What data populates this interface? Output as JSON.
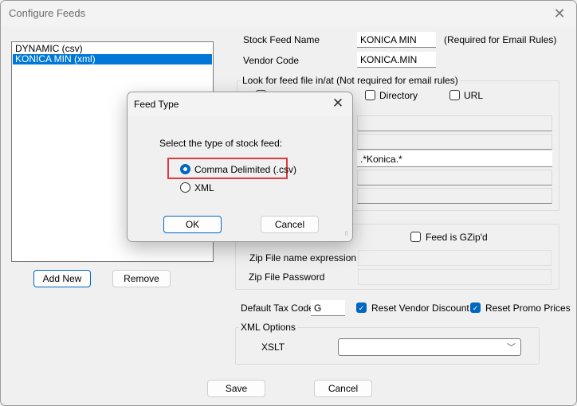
{
  "window": {
    "title": "Configure Feeds",
    "close_icon": "close-icon"
  },
  "feeds_list": {
    "items": [
      {
        "label": "DYNAMIC (csv)",
        "selected": false
      },
      {
        "label": "KONICA MIN (xml)",
        "selected": true
      }
    ]
  },
  "list_buttons": {
    "add_new": "Add New",
    "remove": "Remove"
  },
  "form": {
    "stock_feed_name_label": "Stock Feed Name",
    "stock_feed_name_value": "KONICA MIN",
    "stock_feed_name_hint": "(Required for Email Rules)",
    "vendor_code_label": "Vendor Code",
    "vendor_code_value": "KONICA.MIN",
    "look_for_group_label": "Look for feed file in/at (Not required for email rules)",
    "directory_label": "Directory",
    "directory_checked": false,
    "url_label": "URL",
    "url_checked": false,
    "field_values": [
      "",
      "",
      ".*Konica.*",
      "",
      ""
    ],
    "feed_gzip_label": "Feed is GZip'd",
    "feed_gzip_checked": false,
    "zip_name_label": "Zip File name expression",
    "zip_name_value": "",
    "zip_password_label": "Zip File Password",
    "zip_password_value": "",
    "default_tax_code_label": "Default Tax Code",
    "default_tax_code_value": "G",
    "reset_vendor_discount_label": "Reset Vendor Discount",
    "reset_vendor_discount_checked": true,
    "reset_promo_prices_label": "Reset Promo Prices",
    "reset_promo_prices_checked": true,
    "xml_options_label": "XML Options",
    "xslt_label": "XSLT",
    "xslt_value": ""
  },
  "footer": {
    "save": "Save",
    "cancel": "Cancel"
  },
  "modal": {
    "title": "Feed Type",
    "prompt": "Select the type of stock feed:",
    "options": [
      {
        "label": "Comma Delimited (.csv)",
        "checked": true
      },
      {
        "label": "XML",
        "checked": false
      }
    ],
    "ok": "OK",
    "cancel": "Cancel",
    "highlight_color": "#e03a3e",
    "accent_color": "#0067c0"
  }
}
